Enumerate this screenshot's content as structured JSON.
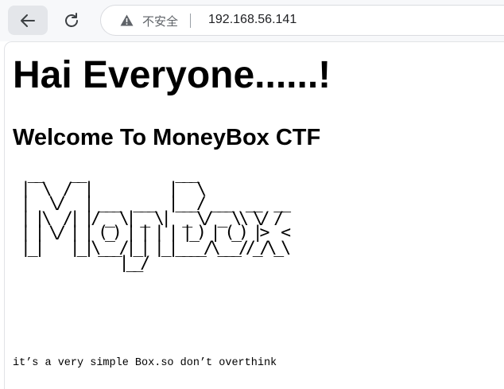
{
  "browser": {
    "back_icon": "arrow-left-icon",
    "reload_icon": "reload-icon",
    "security_icon": "warning-triangle-icon",
    "security_label": "不安全",
    "url": "192.168.56.141"
  },
  "page": {
    "heading": "Hai Everyone......!",
    "subheading": "Welcome To MoneyBox CTF",
    "ascii_art": "  __    __             ___\n |  \\  /  |           |   \\\n |   \\/   | ___  ___  |___/ ___  __  __\n | |\\  /| |/ _ \\| _ \\|  _ \\/ _ \\\\ \\/ /\n | | \\/ | | (_) | | | | |_) | (_) |>  <\n |_|    |_|\\___/|_| |_|____/\\___//_/\\_\\\n               |__/\n",
    "footer_text": "it’s a very simple Box.so don’t overthink"
  }
}
